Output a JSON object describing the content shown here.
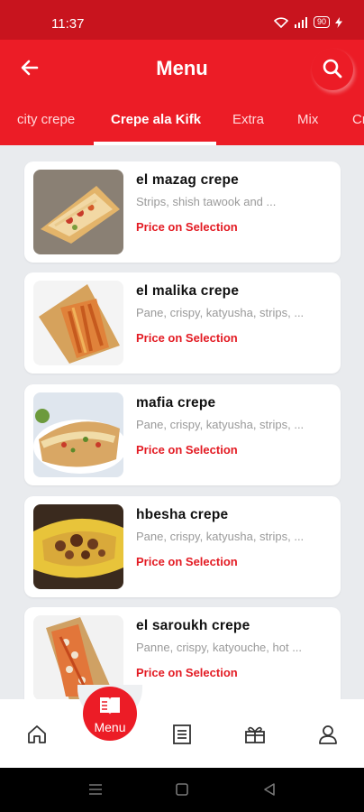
{
  "status_bar": {
    "time": "11:37",
    "battery": "90"
  },
  "header": {
    "title": "Menu"
  },
  "tabs": [
    {
      "label": "city crepe"
    },
    {
      "label": "Crepe ala Kifk"
    },
    {
      "label": "Extra"
    },
    {
      "label": "Mix"
    },
    {
      "label": "Cr"
    }
  ],
  "items": [
    {
      "name": "el mazag crepe",
      "description": "Strips, shish tawook and ...",
      "price": "Price on Selection"
    },
    {
      "name": "el malika crepe",
      "description": "Pane, crispy, katyusha, strips, ...",
      "price": "Price on Selection"
    },
    {
      "name": "mafia crepe",
      "description": "Pane, crispy, katyusha, strips, ...",
      "price": "Price on Selection"
    },
    {
      "name": "hbesha crepe",
      "description": "Pane, crispy, katyusha, strips, ...",
      "price": "Price on Selection"
    },
    {
      "name": "el saroukh crepe",
      "description": "Panne, crispy, katyouche, hot ...",
      "price": "Price on Selection"
    }
  ],
  "bottom_nav": {
    "menu_label": "Menu",
    "items": [
      {
        "icon": "home-icon"
      },
      {
        "icon": "menu-book-icon"
      },
      {
        "icon": "orders-list-icon"
      },
      {
        "icon": "gift-icon"
      },
      {
        "icon": "profile-icon"
      }
    ]
  },
  "colors": {
    "primary": "#ec1c26",
    "status_bar": "#c8141e",
    "price": "#e31b23"
  }
}
